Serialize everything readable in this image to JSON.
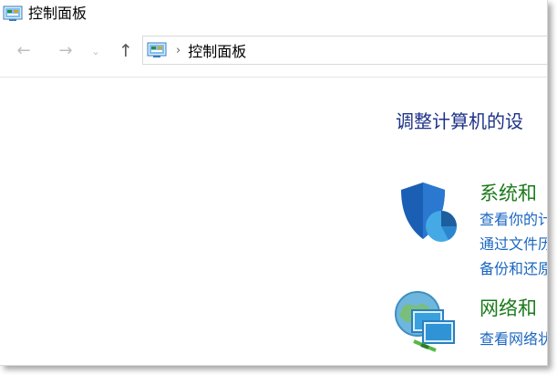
{
  "window": {
    "title": "控制面板"
  },
  "nav": {
    "back_icon": "←",
    "forward_icon": "→",
    "recent_icon": "⌄",
    "up_icon": "↑"
  },
  "address": {
    "separator": "›",
    "path": "控制面板"
  },
  "main": {
    "heading": "调整计算机的设",
    "categories": [
      {
        "title": "系统和",
        "icon": "shield-icon",
        "links": [
          "查看你的计",
          "通过文件历",
          "备份和还原"
        ]
      },
      {
        "title": "网络和",
        "icon": "network-globe-icon",
        "links": [
          "查看网络状"
        ]
      }
    ]
  }
}
